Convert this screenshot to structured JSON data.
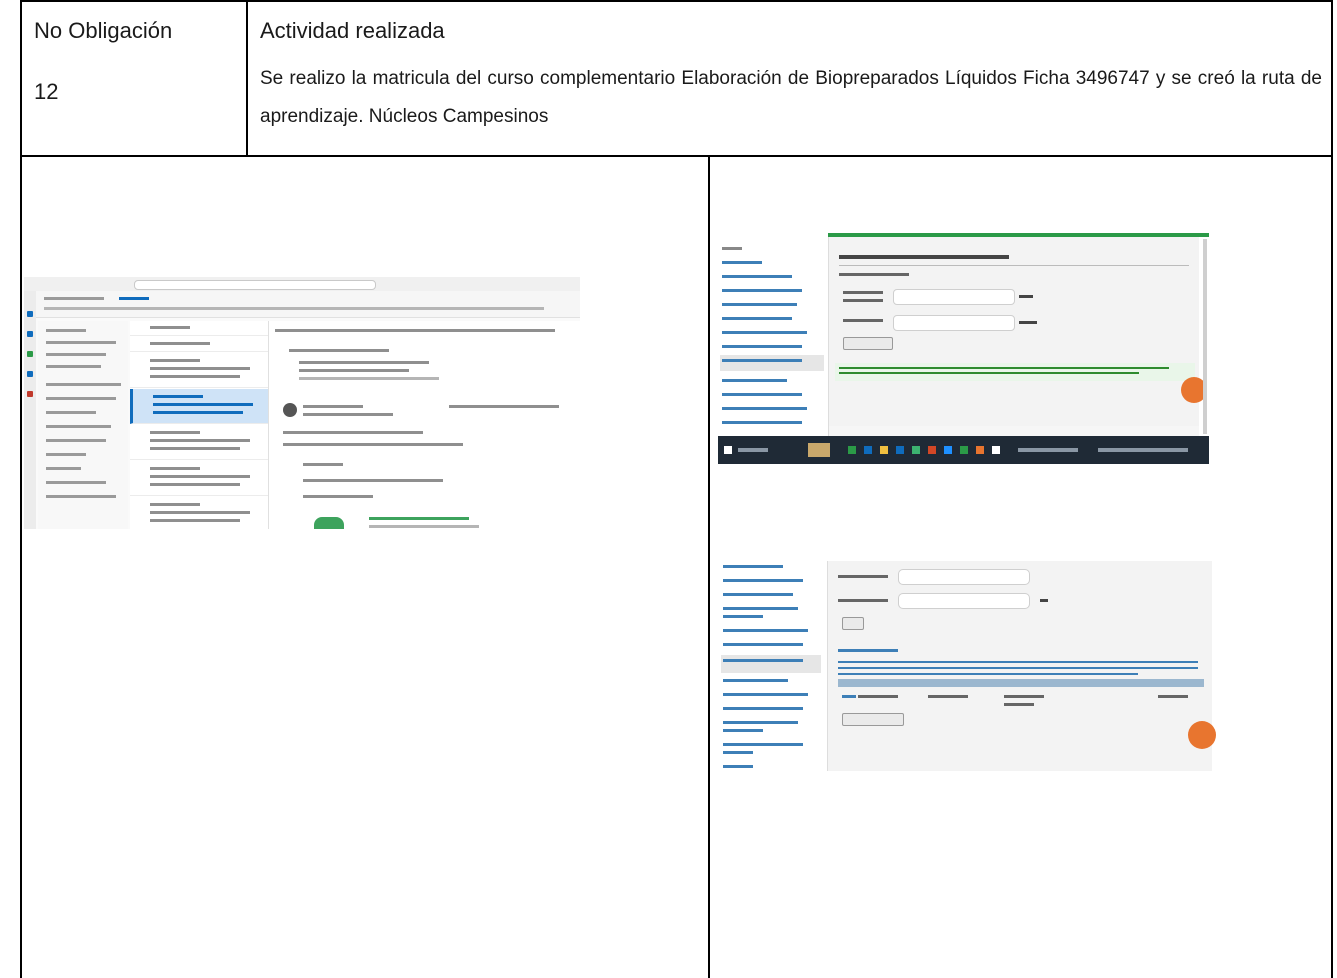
{
  "header": {
    "obligation_label": "No Obligación",
    "obligation_number": "12",
    "activity_label": "Actividad realizada",
    "activity_description": "Se realizo la matricula del curso complementario Elaboración de Biopreparados Líquidos Ficha 3496747 y se creó la ruta de aprendizaje. Núcleos Campesinos"
  },
  "colors": {
    "mail_accent": "#0f6cbd",
    "sena_green": "#2b9a47",
    "sena_orange": "#e8752f"
  }
}
